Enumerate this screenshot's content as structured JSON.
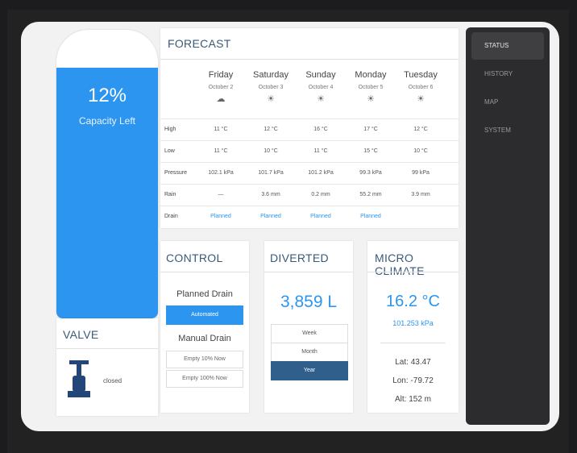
{
  "tank": {
    "percent_label": "12%",
    "caption": "Capacity Left",
    "capacity_left_fraction": 0.87
  },
  "valve": {
    "title": "VALVE",
    "state": "closed"
  },
  "forecast": {
    "title": "FORECAST",
    "days": [
      {
        "name": "Friday",
        "date": "October 2",
        "icon": "☁"
      },
      {
        "name": "Saturday",
        "date": "October 3",
        "icon": "☀"
      },
      {
        "name": "Sunday",
        "date": "October 4",
        "icon": "☀"
      },
      {
        "name": "Monday",
        "date": "October 5",
        "icon": "☀"
      },
      {
        "name": "Tuesday",
        "date": "October 6",
        "icon": "☀"
      }
    ],
    "rows": [
      {
        "label": "High",
        "values": [
          "11 °C",
          "12 °C",
          "16 °C",
          "17 °C",
          "12 °C"
        ]
      },
      {
        "label": "Low",
        "values": [
          "11 °C",
          "10 °C",
          "11 °C",
          "15 °C",
          "10 °C"
        ]
      },
      {
        "label": "Pressure",
        "values": [
          "102.1 kPa",
          "101.7 kPa",
          "101.2 kPa",
          "99.3 kPa",
          "99 kPa"
        ]
      },
      {
        "label": "Rain",
        "values": [
          "—",
          "3.6 mm",
          "0.2 mm",
          "55.2 mm",
          "3.9 mm"
        ]
      },
      {
        "label": "Drain",
        "values": [
          "Planned",
          "Planned",
          "Planned",
          "Planned",
          ""
        ]
      }
    ]
  },
  "control": {
    "title": "CONTROL",
    "planned_label": "Planned Drain",
    "automated_label": "Automated",
    "manual_label": "Manual Drain",
    "empty10_label": "Empty 10% Now",
    "empty100_label": "Empty 100% Now"
  },
  "diverted": {
    "title": "DIVERTED",
    "amount": "3,859 L",
    "periods": [
      "Week",
      "Month",
      "Year"
    ],
    "active": "Year"
  },
  "micro": {
    "title": "MICRO CLIMATE",
    "temperature": "16.2 °C",
    "pressure": "101.253 kPa",
    "lat": "Lat: 43.47",
    "lon": "Lon: -79.72",
    "alt": "Alt: 152 m"
  },
  "nav": {
    "items": [
      "STATUS",
      "HISTORY",
      "MAP",
      "SYSTEM"
    ],
    "active": "STATUS"
  },
  "colors": {
    "accent": "#2b95f0",
    "active_segment": "#2f5f8a",
    "sidebar": "#2c2c2e"
  }
}
